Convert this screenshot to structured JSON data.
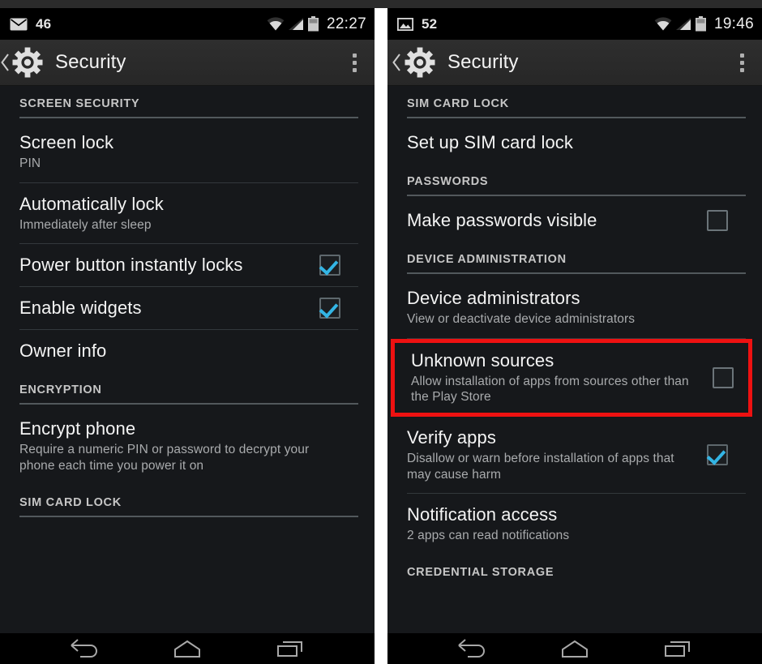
{
  "left_panel": {
    "status_bar": {
      "notification_icon": "mail-icon",
      "notification_count": "46",
      "wifi_icon": "wifi-icon",
      "signal_icon": "cellular-signal-icon",
      "battery_icon": "battery-icon",
      "time": "22:27"
    },
    "action_bar": {
      "back_icon": "back-chevron-icon",
      "app_icon": "settings-gear-icon",
      "title": "Security",
      "overflow_icon": "overflow-menu-icon"
    },
    "sections": [
      {
        "header": "SCREEN SECURITY",
        "rows": [
          {
            "title": "Screen lock",
            "subtitle": "PIN",
            "control": "none"
          },
          {
            "title": "Automatically lock",
            "subtitle": "Immediately after sleep",
            "control": "none"
          },
          {
            "title": "Power button instantly locks",
            "subtitle": "",
            "control": "checkbox",
            "checked": true
          },
          {
            "title": "Enable widgets",
            "subtitle": "",
            "control": "checkbox",
            "checked": true
          },
          {
            "title": "Owner info",
            "subtitle": "",
            "control": "none"
          }
        ]
      },
      {
        "header": "ENCRYPTION",
        "rows": [
          {
            "title": "Encrypt phone",
            "subtitle": "Require a numeric PIN or password to decrypt your phone each time you power it on",
            "control": "none"
          }
        ]
      },
      {
        "header": "SIM CARD LOCK",
        "rows": []
      }
    ],
    "nav_bar": {
      "back": "nav-back-icon",
      "home": "nav-home-icon",
      "recents": "nav-recents-icon"
    }
  },
  "right_panel": {
    "status_bar": {
      "notification_icon": "image-icon",
      "notification_count": "52",
      "wifi_icon": "wifi-icon",
      "signal_icon": "cellular-signal-icon",
      "battery_icon": "battery-icon",
      "time": "19:46"
    },
    "action_bar": {
      "back_icon": "back-chevron-icon",
      "app_icon": "settings-gear-icon",
      "title": "Security",
      "overflow_icon": "overflow-menu-icon"
    },
    "sections": [
      {
        "header": "SIM CARD LOCK",
        "rows": [
          {
            "title": "Set up SIM card lock",
            "subtitle": "",
            "control": "none"
          }
        ]
      },
      {
        "header": "PASSWORDS",
        "rows": [
          {
            "title": "Make passwords visible",
            "subtitle": "",
            "control": "checkbox",
            "checked": false
          }
        ]
      },
      {
        "header": "DEVICE ADMINISTRATION",
        "rows": [
          {
            "title": "Device administrators",
            "subtitle": "View or deactivate device administrators",
            "control": "none"
          },
          {
            "title": "Unknown sources",
            "subtitle": "Allow installation of apps from sources other than the Play Store",
            "control": "checkbox",
            "checked": false,
            "highlighted": true
          },
          {
            "title": "Verify apps",
            "subtitle": "Disallow or warn before installation of apps that may cause harm",
            "control": "checkbox",
            "checked": true
          },
          {
            "title": "Notification access",
            "subtitle": "2 apps can read notifications",
            "control": "none"
          }
        ]
      },
      {
        "header": "CREDENTIAL STORAGE",
        "rows": []
      }
    ],
    "nav_bar": {
      "back": "nav-back-icon",
      "home": "nav-home-icon",
      "recents": "nav-recents-icon"
    }
  },
  "annotation": {
    "highlight_color": "#ee1111",
    "highlight_target": "Unknown sources"
  },
  "colors": {
    "accent_checkbox": "#33b5e5",
    "list_background": "#16181b",
    "action_bar": "#2a2a2a",
    "status_bar": "#000000",
    "title_text": "#f4f4f4",
    "subtitle_text": "#a9abad",
    "section_header_text": "#c6c6c6"
  }
}
